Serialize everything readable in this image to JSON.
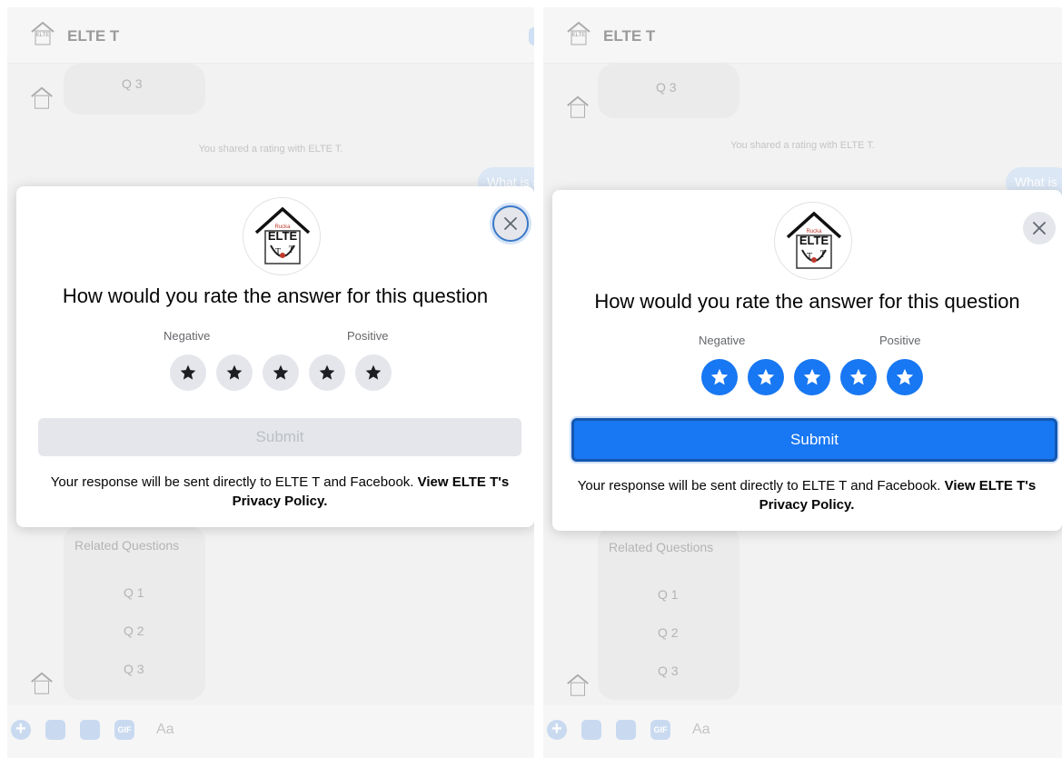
{
  "chat": {
    "title": "ELTE T",
    "top_bubble": "Q 3",
    "shared_note": "You shared a rating with ELTE T.",
    "outgoing_bubble": "What is s",
    "outgoing_bubble_right": "What is",
    "related_header": "Related Questions",
    "related_items": [
      "Q 1",
      "Q 2",
      "Q 3"
    ],
    "composer_placeholder": "Aa",
    "composer_gif": "GIF"
  },
  "modal": {
    "question": "How would you rate the answer for this question",
    "negative_label": "Negative",
    "positive_label": "Positive",
    "star_count": 5,
    "submit_label": "Submit",
    "footer_text": "Your response will be sent directly to ELTE T and Facebook.",
    "footer_link": "View ELTE T's Privacy Policy."
  },
  "states": {
    "left": {
      "selected_rating": 0,
      "submit_enabled": false
    },
    "right": {
      "selected_rating": 5,
      "submit_enabled": true
    }
  },
  "colors": {
    "accent": "#1877f2",
    "star_off_bg": "#e4e6eb",
    "star_off_glyph": "#1c1e21",
    "disabled_button": "#e4e6eb",
    "disabled_text": "#bcc0c4"
  },
  "icons": {
    "close": "close-icon",
    "star": "star-icon",
    "logo": "elte-t-logo",
    "composer": [
      "plus-icon",
      "photo-icon",
      "sticker-icon",
      "gif-icon"
    ]
  }
}
